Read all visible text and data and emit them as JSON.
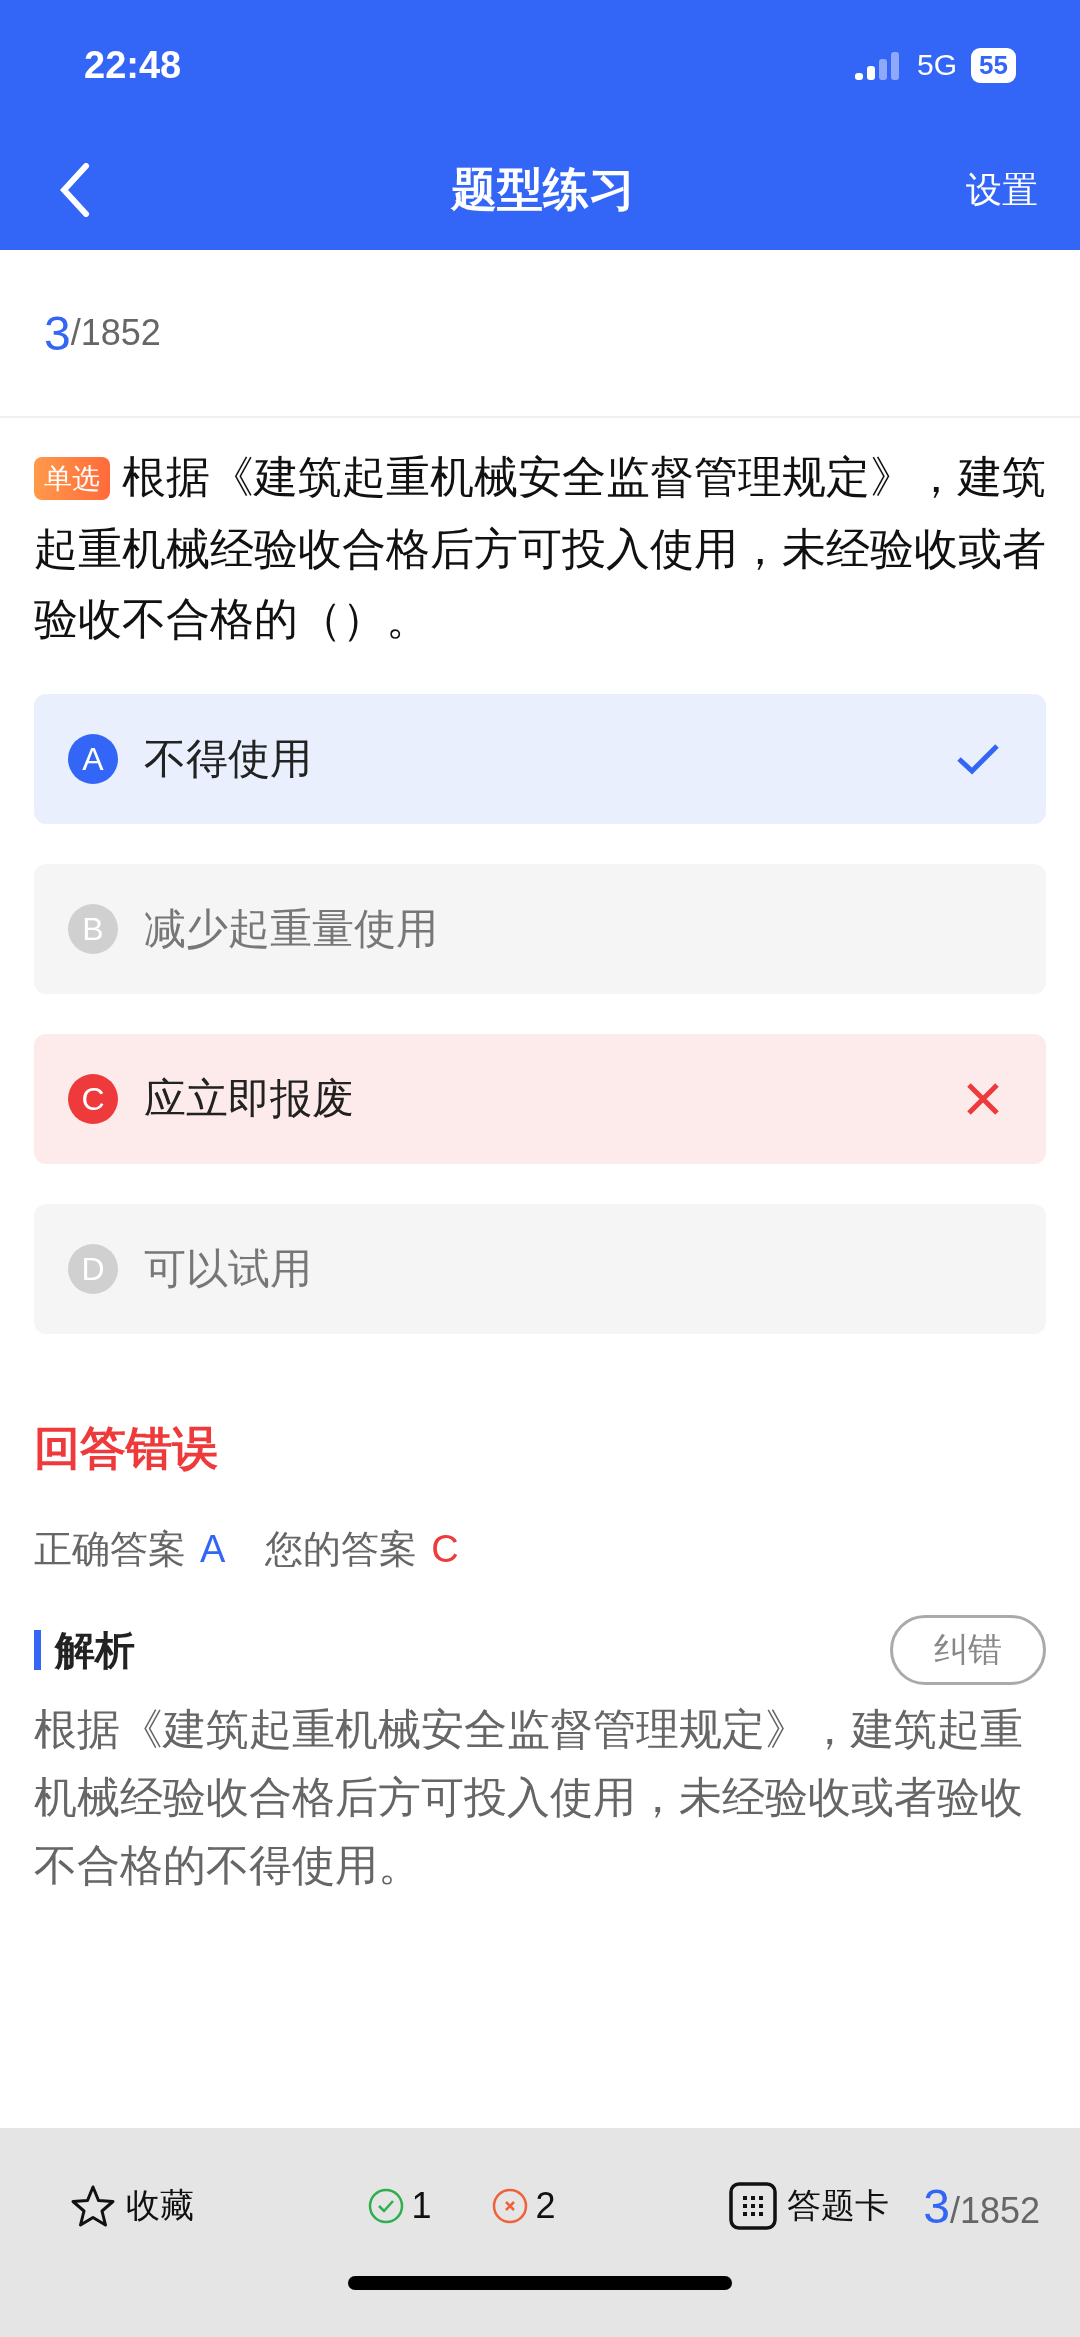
{
  "status_bar": {
    "time": "22:48",
    "network": "5G",
    "battery": "55"
  },
  "nav": {
    "title": "题型练习",
    "action": "设置"
  },
  "progress": {
    "current": "3",
    "total": "/1852"
  },
  "question": {
    "type": "单选",
    "text": "根据《建筑起重机械安全监督管理规定》，建筑起重机械经验收合格后方可投入使用，未经验收或者验收不合格的（）。"
  },
  "options": [
    {
      "letter": "A",
      "text": "不得使用",
      "kind": "correct"
    },
    {
      "letter": "B",
      "text": "减少起重量使用",
      "kind": "plain"
    },
    {
      "letter": "C",
      "text": "应立即报废",
      "kind": "wrong"
    },
    {
      "letter": "D",
      "text": "可以试用",
      "kind": "plain"
    }
  ],
  "result": {
    "title": "回答错误",
    "correct_label": "正确答案",
    "correct_value": "A",
    "yours_label": "您的答案",
    "yours_value": "C"
  },
  "analysis": {
    "title": "解析",
    "report": "纠错",
    "text": "根据《建筑起重机械安全监督管理规定》，建筑起重机械经验收合格后方可投入使用，未经验收或者验收不合格的不得使用。"
  },
  "bottom_bar": {
    "favorite": "收藏",
    "right_count": "1",
    "wrong_count": "2",
    "card": "答题卡",
    "current": "3",
    "total": "/1852"
  }
}
